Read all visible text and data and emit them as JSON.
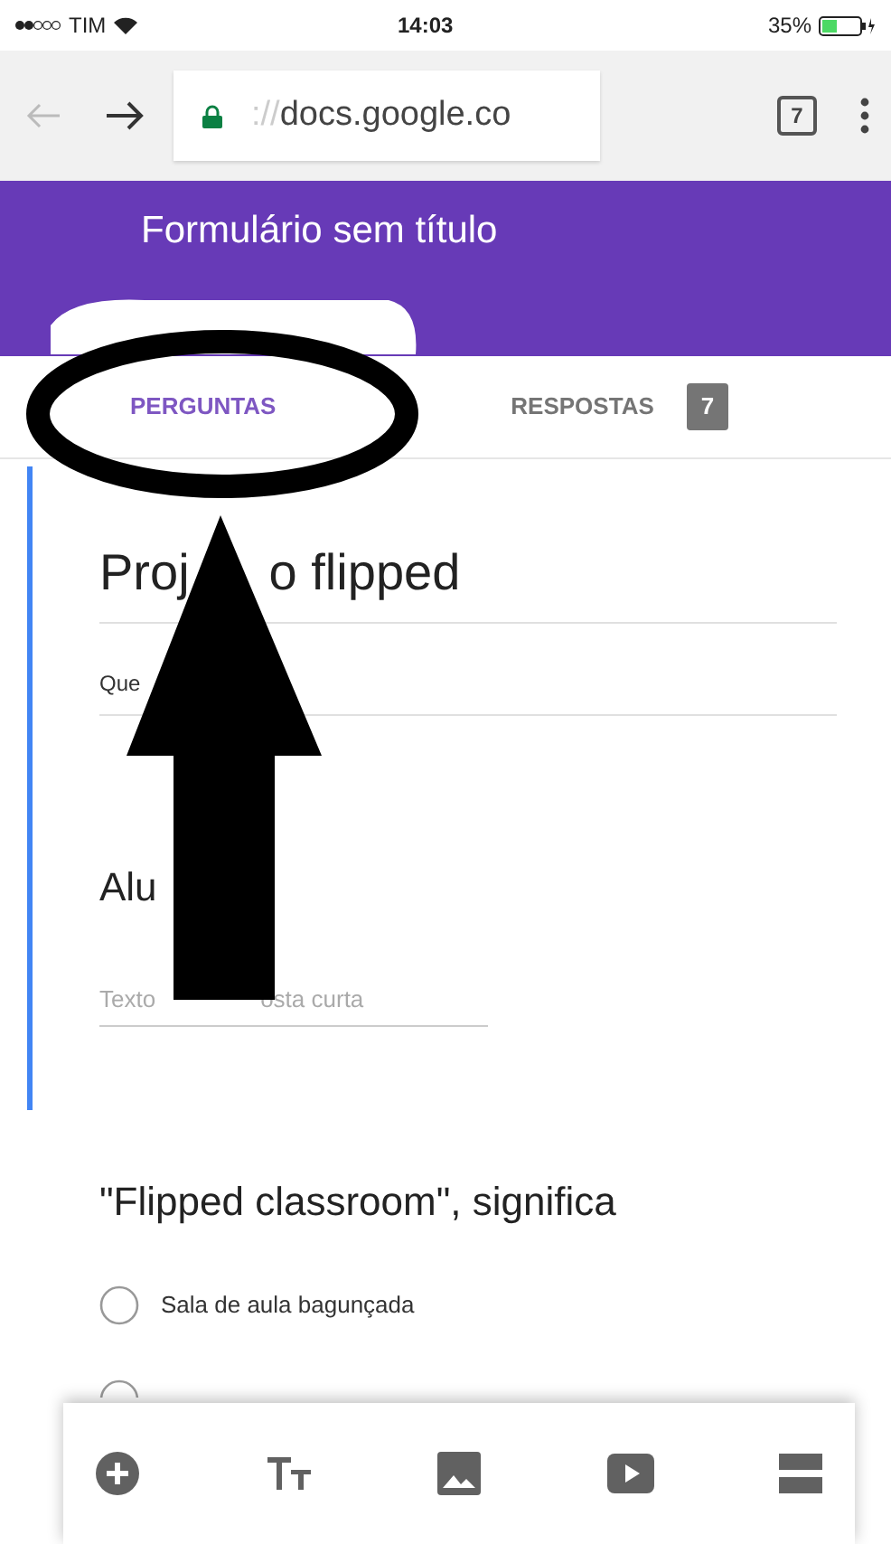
{
  "status_bar": {
    "carrier": "TIM",
    "time": "14:03",
    "battery": "35%"
  },
  "browser": {
    "url_faded": "://",
    "url": "docs.google.co",
    "tab_count": "7"
  },
  "header": {
    "title": "Formulário sem título"
  },
  "tabs": [
    {
      "label": "PERGUNTAS",
      "selected": true
    },
    {
      "label": "RESPOSTAS",
      "selected": false,
      "badge": "7"
    }
  ],
  "form_card": {
    "title_parts": [
      "Proj",
      "o flipped"
    ],
    "description": "Que",
    "question": {
      "title": "Alu",
      "placeholder_parts": [
        "Texto",
        "osta curta"
      ]
    }
  },
  "question": {
    "title": "\"Flipped classroom\", significa",
    "options": [
      {
        "label": "Sala de aula bagunçada",
        "selected": false
      }
    ]
  }
}
